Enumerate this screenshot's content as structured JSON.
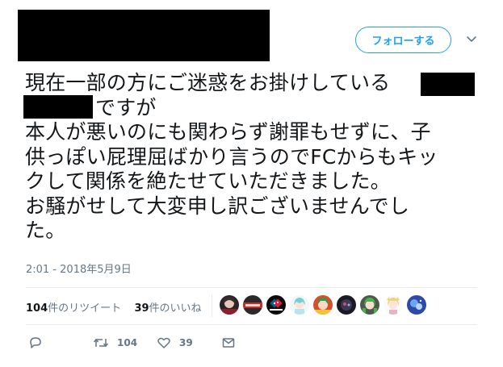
{
  "header": {
    "follow_label": "フォローする",
    "more_icon": "chevron-down-icon"
  },
  "tweet": {
    "lines": [
      "現在一部の方にご迷惑をお掛けしている",
      "ですが",
      "本人が悪いのにも関わらず謝罪もせずに、子",
      "供っぽい屁理屈ばかり言うのでFCからもキッ",
      "クして関係を絶たせていただきました。",
      "お騒がせして大変申し訳ございませんでし",
      "た。"
    ],
    "timestamp": "2:01 - 2018年5月9日"
  },
  "stats": {
    "retweet_count": "104",
    "retweet_label": "件のリツイート",
    "like_count": "39",
    "like_label": "件のいいね"
  },
  "avatars": [
    "dark-anime",
    "red-banner",
    "dominos-logo",
    "anime-teal-hair",
    "anime-green-hair",
    "anime-dark",
    "anime-green-twin",
    "anime-blonde",
    "blue-space"
  ],
  "actions": {
    "reply_icon": "reply-icon",
    "retweet_icon": "retweet-icon",
    "retweet_count": "104",
    "like_icon": "heart-icon",
    "like_count": "39",
    "dm_icon": "mail-icon"
  },
  "colors": {
    "accent": "#1da1f2",
    "text": "#14171a",
    "secondary": "#657786",
    "divider": "#e6ecf0"
  }
}
